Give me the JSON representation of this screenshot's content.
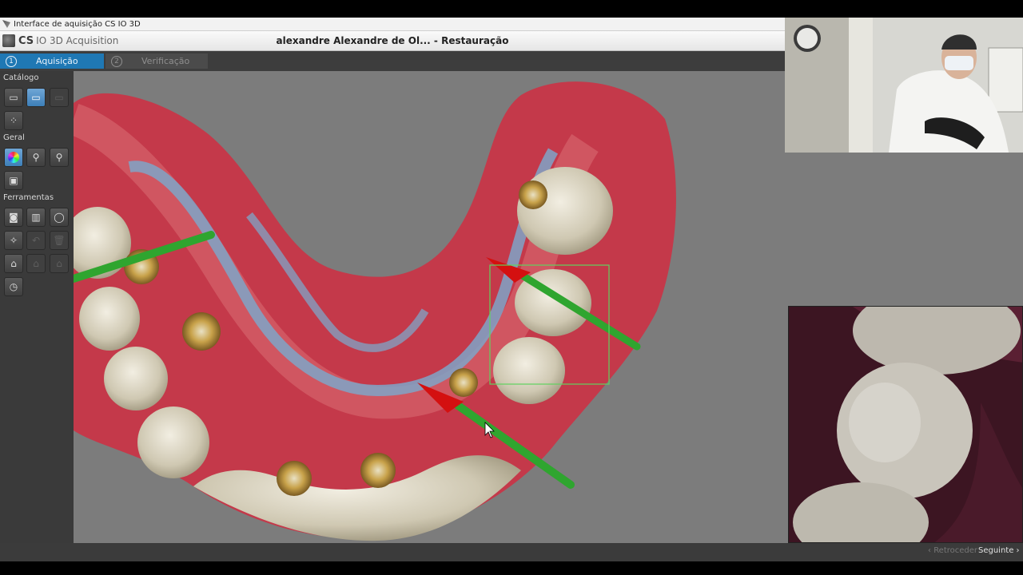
{
  "window": {
    "title": "Interface de aquisição CS IO 3D"
  },
  "app": {
    "brand_short": "CS",
    "brand_name": "IO 3D Acquisition",
    "header_title": "alexandre Alexandre de Ol... - Restauração"
  },
  "tabs": [
    {
      "number": "1",
      "label": "Aquisição",
      "active": true
    },
    {
      "number": "2",
      "label": "Verificação",
      "active": false
    }
  ],
  "sidebar": {
    "sections": [
      {
        "label": "Catálogo"
      },
      {
        "label": "Geral"
      },
      {
        "label": "Ferramentas"
      }
    ]
  },
  "footer": {
    "back_label": "Retroceder",
    "next_label": "Seguinte"
  },
  "colors": {
    "accent": "#1f78b4",
    "gum": "#c4394a",
    "tooth": "#d8d2bf",
    "marker_green": "#2fa52f",
    "marker_red": "#d41010",
    "selection_box": "#5fd35f"
  }
}
